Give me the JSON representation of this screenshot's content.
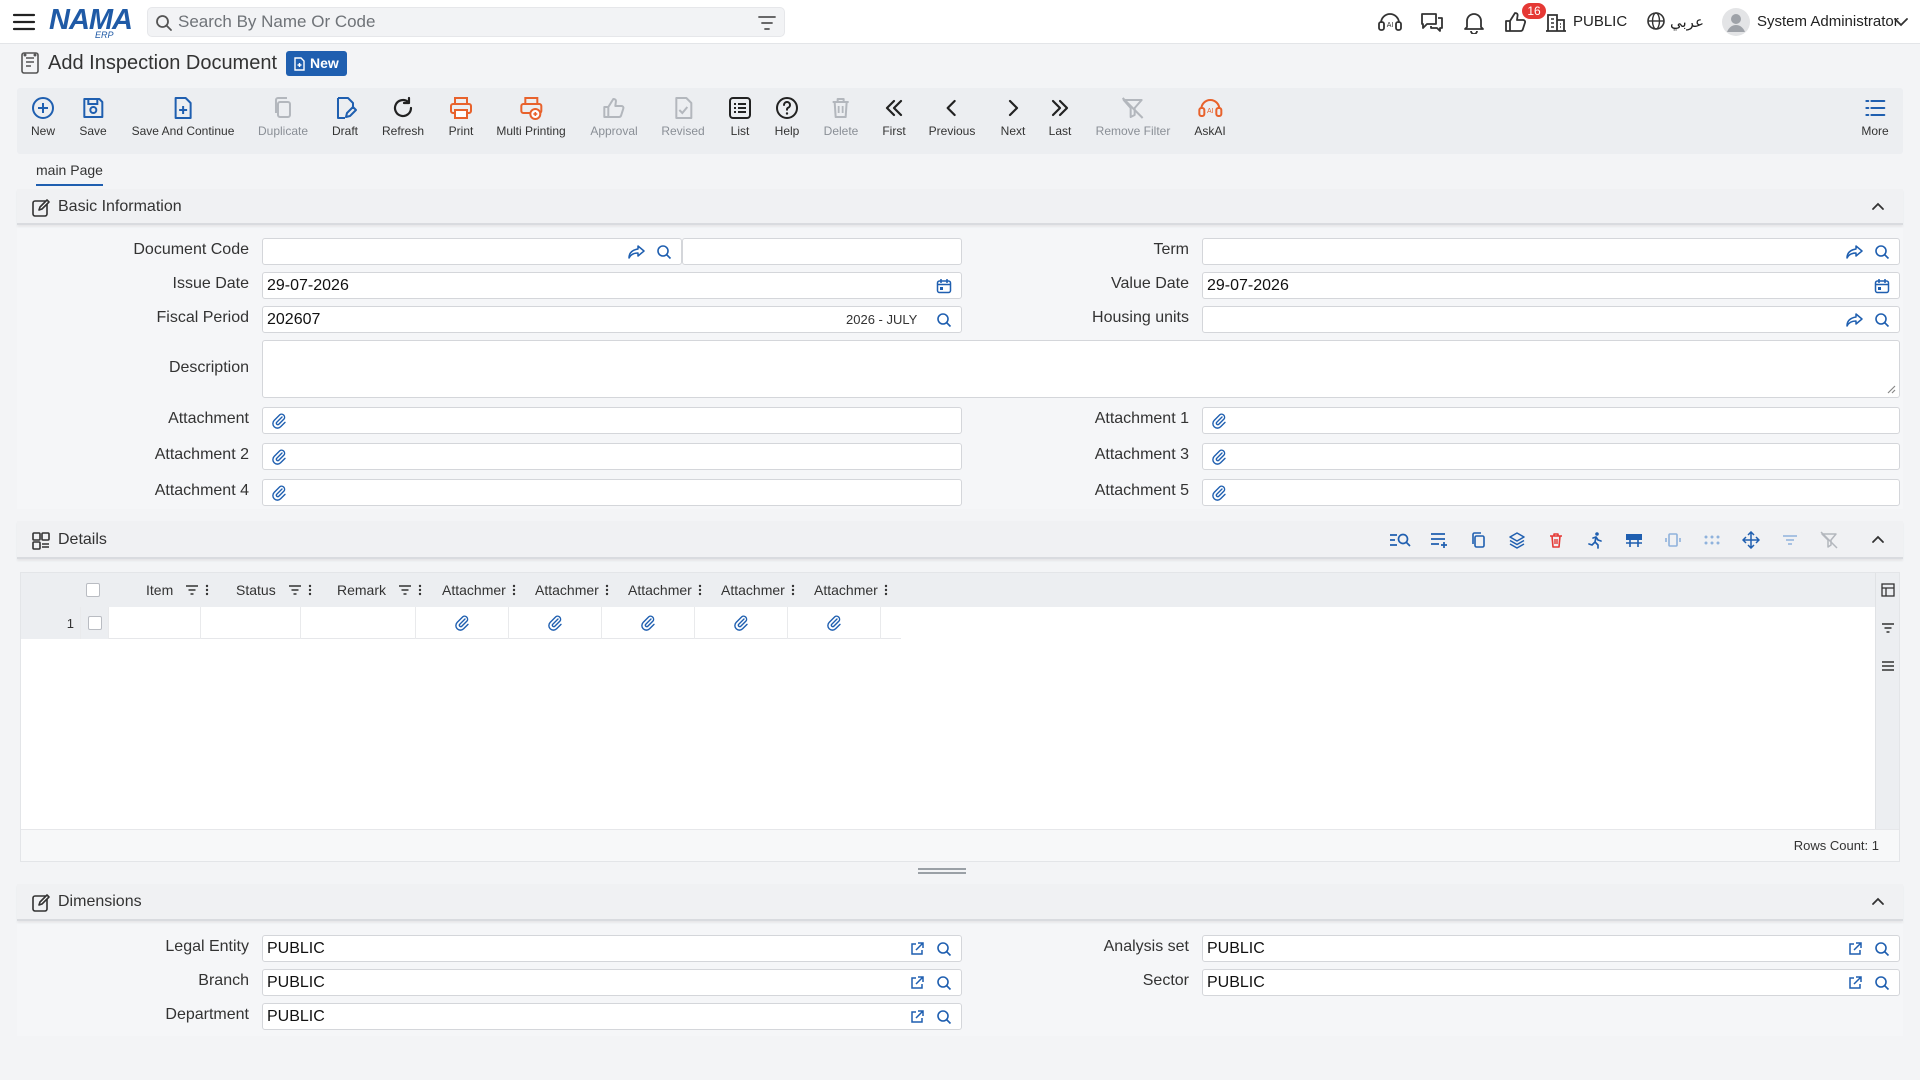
{
  "app": {
    "logo_main": "NAMA",
    "logo_sub": "ERP",
    "search_placeholder": "Search By Name Or Code",
    "notification_count": "16",
    "company": "PUBLIC",
    "language": "عربي",
    "user": "System Administrator"
  },
  "page": {
    "title": "Add Inspection Document",
    "status_badge": "New"
  },
  "toolbar": [
    {
      "label": "New",
      "icon": "plus-circle-icon"
    },
    {
      "label": "Save",
      "icon": "save-icon"
    },
    {
      "label": "Save And Continue",
      "icon": "file-plus-icon"
    },
    {
      "label": "Duplicate",
      "icon": "copy-icon"
    },
    {
      "label": "Draft",
      "icon": "draft-icon"
    },
    {
      "label": "Refresh",
      "icon": "refresh-icon"
    },
    {
      "label": "Print",
      "icon": "print-icon"
    },
    {
      "label": "Multi Printing",
      "icon": "multi-print-icon"
    },
    {
      "label": "Approval",
      "icon": "thumbs-up-icon"
    },
    {
      "label": "Revised",
      "icon": "revised-icon"
    },
    {
      "label": "List",
      "icon": "list-icon"
    },
    {
      "label": "Help",
      "icon": "help-icon"
    },
    {
      "label": "Delete",
      "icon": "trash-icon"
    },
    {
      "label": "First",
      "icon": "first-icon"
    },
    {
      "label": "Previous",
      "icon": "previous-icon"
    },
    {
      "label": "Next",
      "icon": "next-icon"
    },
    {
      "label": "Last",
      "icon": "last-icon"
    },
    {
      "label": "Remove Filter",
      "icon": "remove-filter-icon"
    },
    {
      "label": "AskAI",
      "icon": "ai-icon"
    },
    {
      "label": "More",
      "icon": "more-icon"
    }
  ],
  "tabs": [
    {
      "label": "main Page"
    }
  ],
  "basic_info": {
    "title": "Basic Information",
    "document_code": {
      "label": "Document Code",
      "value": "",
      "name_value": ""
    },
    "term": {
      "label": "Term",
      "value": ""
    },
    "issue_date": {
      "label": "Issue Date",
      "value": "29-07-2026"
    },
    "value_date": {
      "label": "Value Date",
      "value": "29-07-2026"
    },
    "fiscal_period": {
      "label": "Fiscal Period",
      "value": "202607",
      "tag": "2026 - JULY"
    },
    "housing_units": {
      "label": "Housing units",
      "value": ""
    },
    "description": {
      "label": "Description",
      "value": ""
    },
    "attachments": [
      {
        "label": "Attachment"
      },
      {
        "label": "Attachment 1"
      },
      {
        "label": "Attachment 2"
      },
      {
        "label": "Attachment 3"
      },
      {
        "label": "Attachment 4"
      },
      {
        "label": "Attachment 5"
      }
    ]
  },
  "details": {
    "title": "Details",
    "columns": [
      "Item",
      "Status",
      "Remark",
      "Attachmer",
      "Attachmer",
      "Attachmer",
      "Attachmer",
      "Attachmer"
    ],
    "rows": [
      {
        "num": "1"
      }
    ],
    "rows_count": "Rows Count: 1"
  },
  "dimensions": {
    "title": "Dimensions",
    "legal_entity": {
      "label": "Legal Entity",
      "value": "PUBLIC"
    },
    "analysis_set": {
      "label": "Analysis set",
      "value": "PUBLIC"
    },
    "branch": {
      "label": "Branch",
      "value": "PUBLIC"
    },
    "sector": {
      "label": "Sector",
      "value": "PUBLIC"
    },
    "department": {
      "label": "Department",
      "value": "PUBLIC"
    }
  },
  "colors": {
    "primary": "#1f5fb0",
    "accent_orange": "#e8622c",
    "badge_red": "#e53935"
  }
}
